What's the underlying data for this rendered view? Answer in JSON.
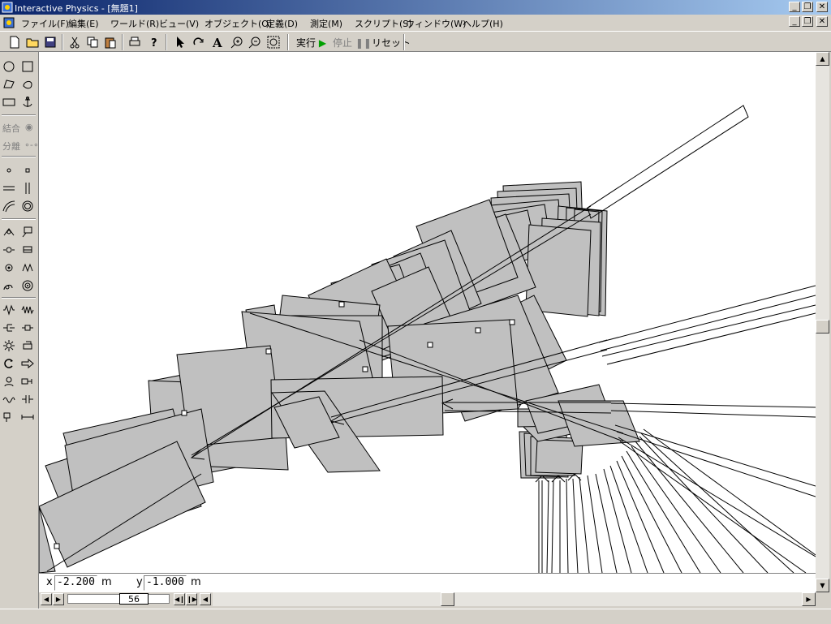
{
  "app": {
    "window_title": "Interactive Physics - [無題1]"
  },
  "menu": {
    "items": [
      "ファイル(F)",
      "編集(E)",
      "ワールド(R)",
      "ビュー(V)",
      "オブジェクト(O)",
      "定義(D)",
      "測定(M)",
      "スクリプト(S)",
      "ウィンドウ(W)",
      "ヘルプ(H)"
    ]
  },
  "toolbar": {
    "run_label": "実行",
    "stop_label": "停止",
    "reset_label": "リセット"
  },
  "palette": {
    "join_label": "結合",
    "split_label": "分離"
  },
  "coords": {
    "x_label": "x",
    "x_value": "-2.200",
    "y_label": "y",
    "y_value": "-1.000",
    "unit": "m"
  },
  "frame": {
    "value": "56"
  },
  "colors": {
    "title_start": "#0a246a",
    "title_end": "#a6caf0",
    "body_fill": "#c0c0c0",
    "run_arrow": "#00a000"
  }
}
